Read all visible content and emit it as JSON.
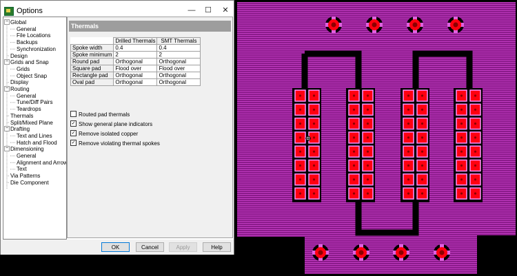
{
  "window": {
    "title": "Options",
    "minimize": "—",
    "maximize": "☐",
    "close": "✕"
  },
  "tree": [
    {
      "label": "Global",
      "level": 0,
      "expander": "−"
    },
    {
      "label": "General",
      "level": 1
    },
    {
      "label": "File Locations",
      "level": 1
    },
    {
      "label": "Backups",
      "level": 1
    },
    {
      "label": "Synchronization",
      "level": 1
    },
    {
      "label": "Design",
      "level": 0
    },
    {
      "label": "Grids and Snap",
      "level": 0,
      "expander": "−"
    },
    {
      "label": "Grids",
      "level": 1
    },
    {
      "label": "Object Snap",
      "level": 1
    },
    {
      "label": "Display",
      "level": 0
    },
    {
      "label": "Routing",
      "level": 0,
      "expander": "−"
    },
    {
      "label": "General",
      "level": 1
    },
    {
      "label": "Tune/Diff Pairs",
      "level": 1
    },
    {
      "label": "Teardrops",
      "level": 1
    },
    {
      "label": "Thermals",
      "level": 0
    },
    {
      "label": "Split/Mixed Plane",
      "level": 0
    },
    {
      "label": "Drafting",
      "level": 0,
      "expander": "−"
    },
    {
      "label": "Text and Lines",
      "level": 1
    },
    {
      "label": "Hatch and Flood",
      "level": 1
    },
    {
      "label": "Dimensioning",
      "level": 0,
      "expander": "−"
    },
    {
      "label": "General",
      "level": 1
    },
    {
      "label": "Alignment and Arrows",
      "level": 1
    },
    {
      "label": "Text",
      "level": 1
    },
    {
      "label": "Via Patterns",
      "level": 0
    },
    {
      "label": "Die Component",
      "level": 0
    }
  ],
  "panel": {
    "title": "Thermals",
    "columns": [
      "Drilled Thermals",
      "SMT Thermals"
    ],
    "rows": [
      {
        "label": "Spoke width",
        "drilled": "0.4",
        "smt": "0.4"
      },
      {
        "label": "Spoke minimum",
        "drilled": "2",
        "smt": "2"
      },
      {
        "label": "Round pad",
        "drilled": "Orthogonal",
        "smt": "Orthogonal"
      },
      {
        "label": "Square pad",
        "drilled": "Flood over",
        "smt": "Flood over"
      },
      {
        "label": "Rectangle pad",
        "drilled": "Orthogonal",
        "smt": "Orthogonal"
      },
      {
        "label": "Oval pad",
        "drilled": "Orthogonal",
        "smt": "Orthogonal"
      }
    ],
    "checkboxes": [
      {
        "label": "Routed pad thermals",
        "checked": false
      },
      {
        "label": "Show general plane indicators",
        "checked": true
      },
      {
        "label": "Remove isolated copper",
        "checked": true
      },
      {
        "label": "Remove violating thermal spokes",
        "checked": true
      }
    ],
    "check_glyph": "✓"
  },
  "buttons": {
    "ok": "OK",
    "cancel": "Cancel",
    "apply": "Apply",
    "help": "Help"
  },
  "colors": {
    "copper_plane": "#a020a0",
    "hatch_line": "#c040c0",
    "pad_red": "#ff0010",
    "pad_border": "#ff90ff",
    "hole": "#8b0000",
    "void": "#000000"
  }
}
